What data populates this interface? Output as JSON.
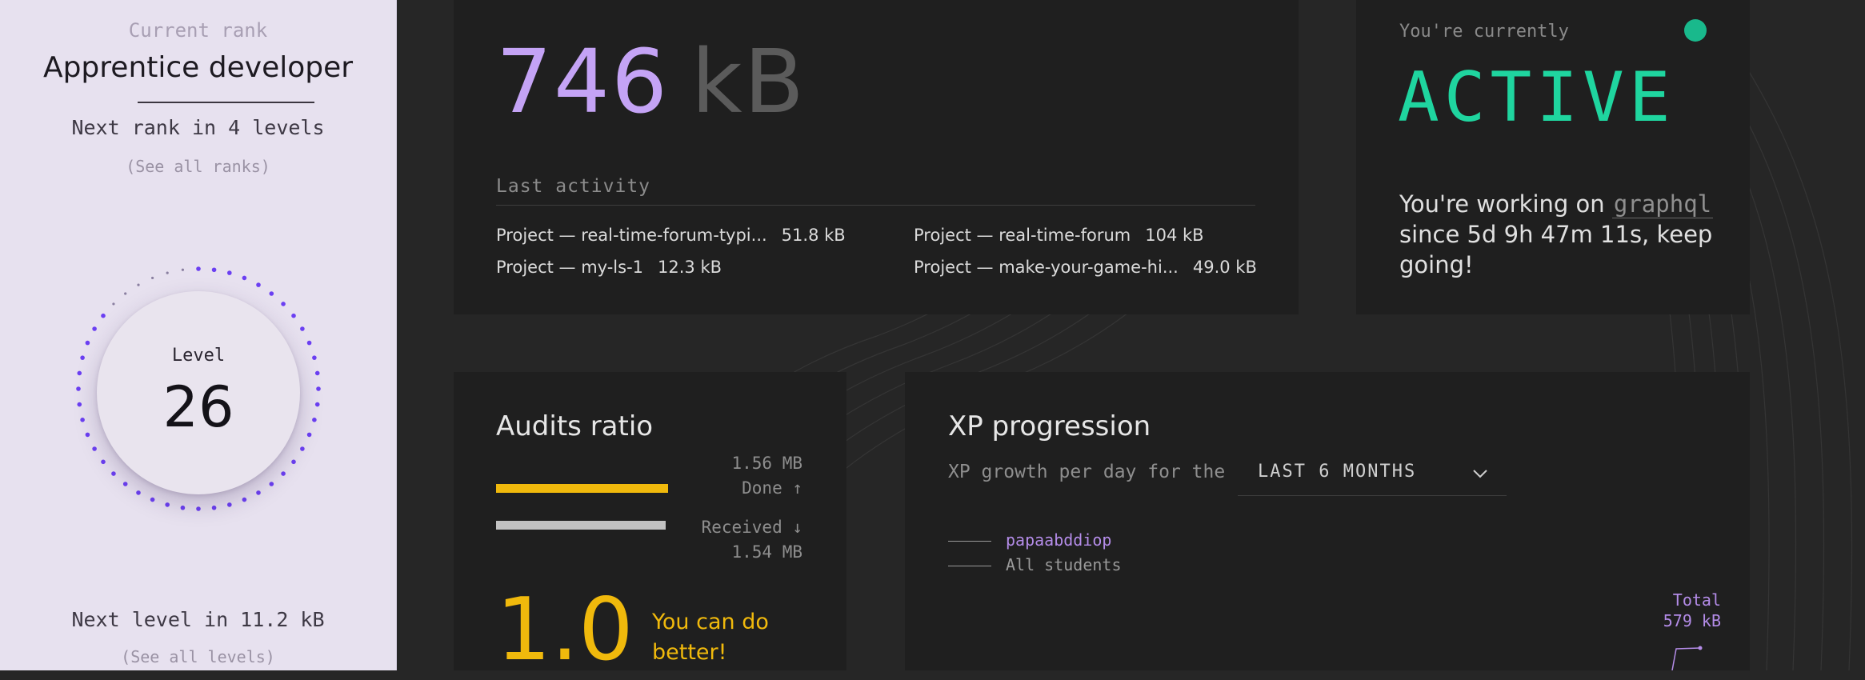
{
  "sidebar": {
    "current_rank_label": "Current rank",
    "rank_name": "Apprentice developer",
    "next_rank_text": "Next rank in 4 levels",
    "see_all_ranks": "(See all ranks)",
    "level_label": "Level",
    "level_value": "26",
    "level_progress_fraction": 0.13,
    "next_level_text": "Next level in 11.2 kB",
    "see_all_levels": "(See all levels)"
  },
  "xp": {
    "value": "746",
    "unit": "kB"
  },
  "last_activity": {
    "title": "Last activity",
    "items": [
      {
        "label": "Project — real-time-forum-typi...",
        "size": "51.8 kB"
      },
      {
        "label": "Project — real-time-forum",
        "size": "104 kB"
      },
      {
        "label": "Project — my-ls-1",
        "size": "12.3 kB"
      },
      {
        "label": "Project — make-your-game-hi...",
        "size": "49.0 kB"
      }
    ]
  },
  "status": {
    "label": "You're currently",
    "value": "ACTIVE",
    "working_prefix": "You're working on",
    "project": "graphql",
    "working_suffix": "since 5d 9h 47m 11s, keep going!",
    "indicator_color": "#19b98c"
  },
  "audits": {
    "title": "Audits ratio",
    "done_amount": "1.56 MB",
    "done_label": "Done ↑",
    "received_label": "Received ↓",
    "received_amount": "1.54 MB",
    "ratio": "1.0",
    "message": "You can do better!",
    "accent_color": "#f0b90c"
  },
  "progression": {
    "title": "XP progression",
    "subtitle": "XP growth per day for the",
    "period_selected": "LAST 6 MONTHS",
    "legend": [
      {
        "name": "papaabddiop",
        "color": "#b48ce8"
      },
      {
        "name": "All students",
        "color": "#9a9a9a"
      }
    ],
    "total_label": "Total",
    "total_value": "579 kB"
  }
}
